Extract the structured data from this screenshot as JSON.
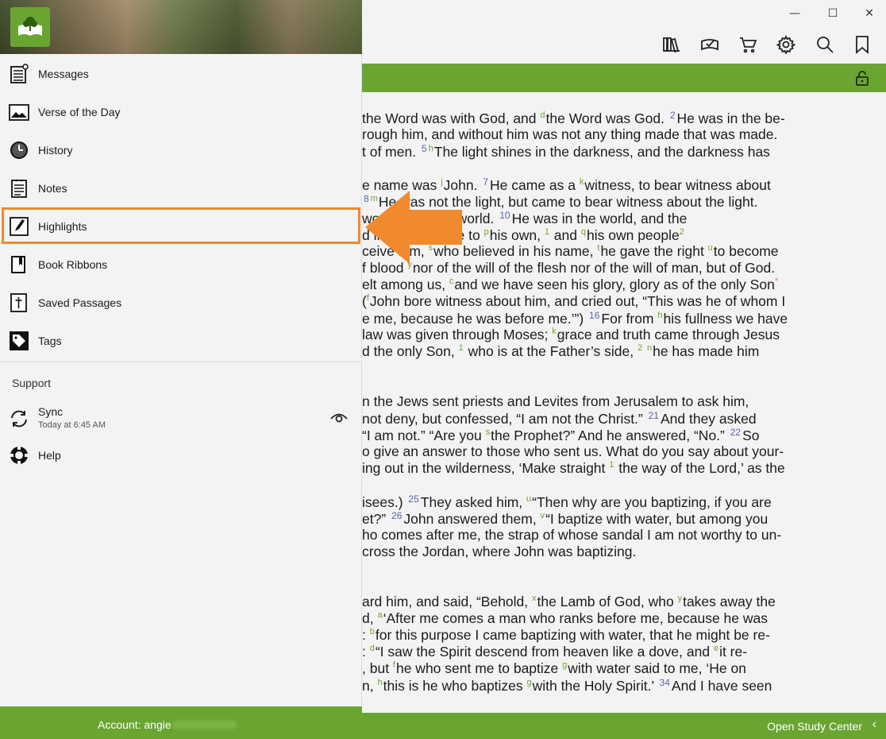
{
  "window": {
    "minimize_glyph": "—",
    "maximize_glyph": "☐",
    "close_glyph": "✕"
  },
  "toolbar": {
    "icons": [
      "library-icon",
      "reading-plans-icon",
      "cart-icon",
      "settings-icon",
      "search-icon",
      "bookmark-icon"
    ]
  },
  "panel": {
    "items": [
      {
        "name": "messages",
        "label": "Messages"
      },
      {
        "name": "verse-of-the-day",
        "label": "Verse of the Day"
      },
      {
        "name": "history",
        "label": "History"
      },
      {
        "name": "notes",
        "label": "Notes"
      },
      {
        "name": "highlights",
        "label": "Highlights"
      },
      {
        "name": "book-ribbons",
        "label": "Book Ribbons"
      },
      {
        "name": "saved-passages",
        "label": "Saved Passages"
      },
      {
        "name": "tags",
        "label": "Tags"
      }
    ],
    "support_header": "Support",
    "sync": {
      "label": "Sync",
      "subtitle": "Today at 6:45 AM"
    },
    "help_label": "Help",
    "account_label": "Account: angie"
  },
  "reader": {
    "open_study_center": "Open Study Center",
    "lines": [
      [
        [
          "t",
          "the Word was with God, and "
        ],
        [
          "s",
          "d"
        ],
        [
          "t",
          "the Word was God. "
        ],
        [
          "v",
          "2"
        ],
        [
          "t",
          "He was in the be-"
        ]
      ],
      [
        [
          "t",
          "rough him, and without him was not any thing made that was made."
        ]
      ],
      [
        [
          "t",
          "t of men. "
        ],
        [
          "v",
          "5"
        ],
        [
          "s",
          "h"
        ],
        [
          "t",
          "The light shines in the darkness, and the darkness has"
        ]
      ],
      [],
      [
        [
          "t",
          "e name was "
        ],
        [
          "s",
          "j"
        ],
        [
          "t",
          "John. "
        ],
        [
          "v",
          "7"
        ],
        [
          "t",
          "He came as a "
        ],
        [
          "s",
          "k"
        ],
        [
          "t",
          "witness, to bear witness about"
        ]
      ],
      [
        [
          "t",
          "  "
        ],
        [
          "v",
          "8"
        ],
        [
          "s",
          "m"
        ],
        [
          "t",
          "He was not the light, but came to bear witness about the light."
        ]
      ],
      [
        [
          "t",
          "wor          ng into the world. "
        ],
        [
          "v",
          "10"
        ],
        [
          "t",
          "He was in the world, and the"
        ]
      ],
      [
        [
          "t",
          "  d         im. "
        ],
        [
          "v",
          "11"
        ],
        [
          "t",
          "He came to "
        ],
        [
          "s",
          "p"
        ],
        [
          "t",
          "his own, "
        ],
        [
          "s",
          "1"
        ],
        [
          "t",
          " and "
        ],
        [
          "s",
          "q"
        ],
        [
          "t",
          "his own people"
        ],
        [
          "s",
          "2"
        ]
      ],
      [
        [
          "t",
          "ceive him, "
        ],
        [
          "s",
          "s"
        ],
        [
          "t",
          "who believed in his name, "
        ],
        [
          "s",
          "t"
        ],
        [
          "t",
          "he gave the right "
        ],
        [
          "s",
          "u"
        ],
        [
          "t",
          "to become"
        ]
      ],
      [
        [
          "t",
          "f blood "
        ],
        [
          "s",
          "y"
        ],
        [
          "t",
          "nor of the will of the flesh nor of the will of man, but of God."
        ]
      ],
      [
        [
          "t",
          "elt among us, "
        ],
        [
          "s",
          "c"
        ],
        [
          "t",
          "and we have seen his glory, glory as of the only Son"
        ],
        [
          "a",
          "*"
        ]
      ],
      [
        [
          "t",
          "("
        ],
        [
          "s",
          "f"
        ],
        [
          "t",
          "John bore witness about him, and cried out, “This was he of whom I"
        ]
      ],
      [
        [
          "t",
          "e me, because he was before me.’”) "
        ],
        [
          "v",
          "16"
        ],
        [
          "t",
          "For from "
        ],
        [
          "s",
          "h"
        ],
        [
          "t",
          "his fullness we have"
        ]
      ],
      [
        [
          "t",
          " law was given through Moses; "
        ],
        [
          "s",
          "k"
        ],
        [
          "t",
          "grace and truth came through Jesus"
        ]
      ],
      [
        [
          "t",
          "d the only Son, "
        ],
        [
          "s",
          "1"
        ],
        [
          "t",
          " who is at the Father’s side, "
        ],
        [
          "s",
          "2"
        ],
        [
          "t",
          " "
        ],
        [
          "s",
          "n"
        ],
        [
          "t",
          "he has made him"
        ]
      ],
      [],
      [],
      [
        [
          "t",
          "n the Jews sent priests and Levites from Jerusalem to ask him,"
        ]
      ],
      [
        [
          "t",
          " not deny, but confessed, “I am not the Christ.” "
        ],
        [
          "v",
          "21"
        ],
        [
          "t",
          "And they asked"
        ]
      ],
      [
        [
          "t",
          "  “I am not.” “Are you "
        ],
        [
          "s",
          "s"
        ],
        [
          "t",
          "the Prophet?” And he answered, “No.” "
        ],
        [
          "v",
          "22"
        ],
        [
          "t",
          "So"
        ]
      ],
      [
        [
          "t",
          "o give an answer to those who sent us. What do you say about your-"
        ]
      ],
      [
        [
          "t",
          "ing out in the wilderness, ‘Make straight "
        ],
        [
          "s",
          "1"
        ],
        [
          "t",
          " the way of the Lord,’ as the"
        ]
      ],
      [],
      [
        [
          "t",
          "isees.) "
        ],
        [
          "v",
          "25"
        ],
        [
          "t",
          "They asked him, "
        ],
        [
          "s",
          "u"
        ],
        [
          "t",
          "“Then why are you baptizing, if you are"
        ]
      ],
      [
        [
          "t",
          "et?” "
        ],
        [
          "v",
          "26"
        ],
        [
          "t",
          "John answered them, "
        ],
        [
          "s",
          "v"
        ],
        [
          "t",
          "“I baptize with water, but among you"
        ]
      ],
      [
        [
          "t",
          "ho comes after me, the strap of whose sandal I am not worthy to un-"
        ]
      ],
      [
        [
          "t",
          "cross the Jordan, where John was baptizing."
        ]
      ],
      [],
      [],
      [
        [
          "t",
          "ard him, and said, “Behold, "
        ],
        [
          "s",
          "x"
        ],
        [
          "t",
          "the Lamb of God, who "
        ],
        [
          "s",
          "y"
        ],
        [
          "t",
          "takes away the"
        ]
      ],
      [
        [
          "t",
          "d, "
        ],
        [
          "s",
          "a"
        ],
        [
          "t",
          "‘After me comes a man who ranks before me, because he was"
        ]
      ],
      [
        [
          "t",
          ": "
        ],
        [
          "s",
          "b"
        ],
        [
          "t",
          "for this purpose I came baptizing with water, that he might be re-"
        ]
      ],
      [
        [
          "t",
          ": "
        ],
        [
          "s",
          "d"
        ],
        [
          "t",
          "“I saw the Spirit descend from heaven like a dove, and "
        ],
        [
          "s",
          "e"
        ],
        [
          "t",
          "it re-"
        ]
      ],
      [
        [
          "t",
          ", but "
        ],
        [
          "s",
          "f"
        ],
        [
          "t",
          "he who sent me to baptize "
        ],
        [
          "s",
          "g"
        ],
        [
          "t",
          "with water said to me, ‘He on"
        ]
      ],
      [
        [
          "t",
          "n, "
        ],
        [
          "s",
          "h"
        ],
        [
          "t",
          "this is he who baptizes "
        ],
        [
          "s",
          "g"
        ],
        [
          "t",
          "with the Holy Spirit.’ "
        ],
        [
          "v",
          "34"
        ],
        [
          "t",
          "And I have seen"
        ]
      ]
    ]
  },
  "colors": {
    "brand_green": "#6aa532",
    "arrow_orange": "#f08a2c",
    "highlight_border": "#f08a2c"
  }
}
